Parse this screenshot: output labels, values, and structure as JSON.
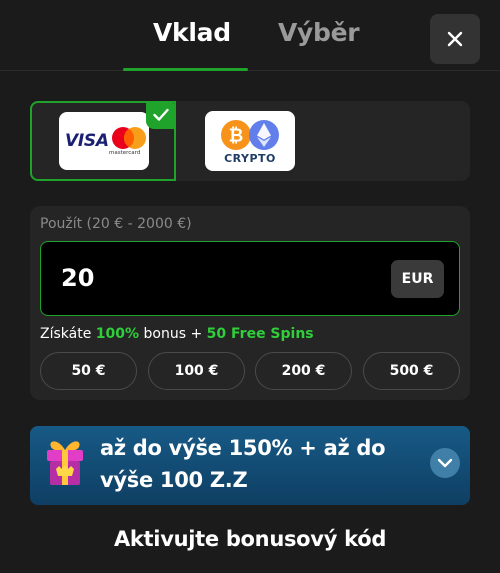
{
  "header": {
    "tabs": [
      {
        "label": "Vklad",
        "active": true
      },
      {
        "label": "Výběr",
        "active": false
      }
    ],
    "close_icon": "close-icon"
  },
  "payment_methods": [
    {
      "id": "card",
      "logo_text": "VISA",
      "logo_subtext": "mastercard",
      "selected": true,
      "check_icon": "check-icon"
    },
    {
      "id": "crypto",
      "logo_text": "CRYPTO",
      "selected": false
    }
  ],
  "amount": {
    "label": "Použít (20 € - 2000 €)",
    "value": "20",
    "currency": "EUR",
    "bonus": {
      "prefix": "Získáte",
      "percent": "100%",
      "middle": "bonus +",
      "spins": "50 Free Spins"
    },
    "presets": [
      "50 €",
      "100 €",
      "200 €",
      "500 €"
    ]
  },
  "promo": {
    "text": "až do výše 150% + až do výše 100 Z.Z",
    "icon": "gift-icon",
    "toggle_icon": "chevron-down-icon"
  },
  "activate_code_label": "Aktivujte bonusový kód",
  "colors": {
    "background": "#1b1b1b",
    "panel": "#252525",
    "accent_green": "#1fa32a",
    "promo_blue": "#175a86"
  }
}
